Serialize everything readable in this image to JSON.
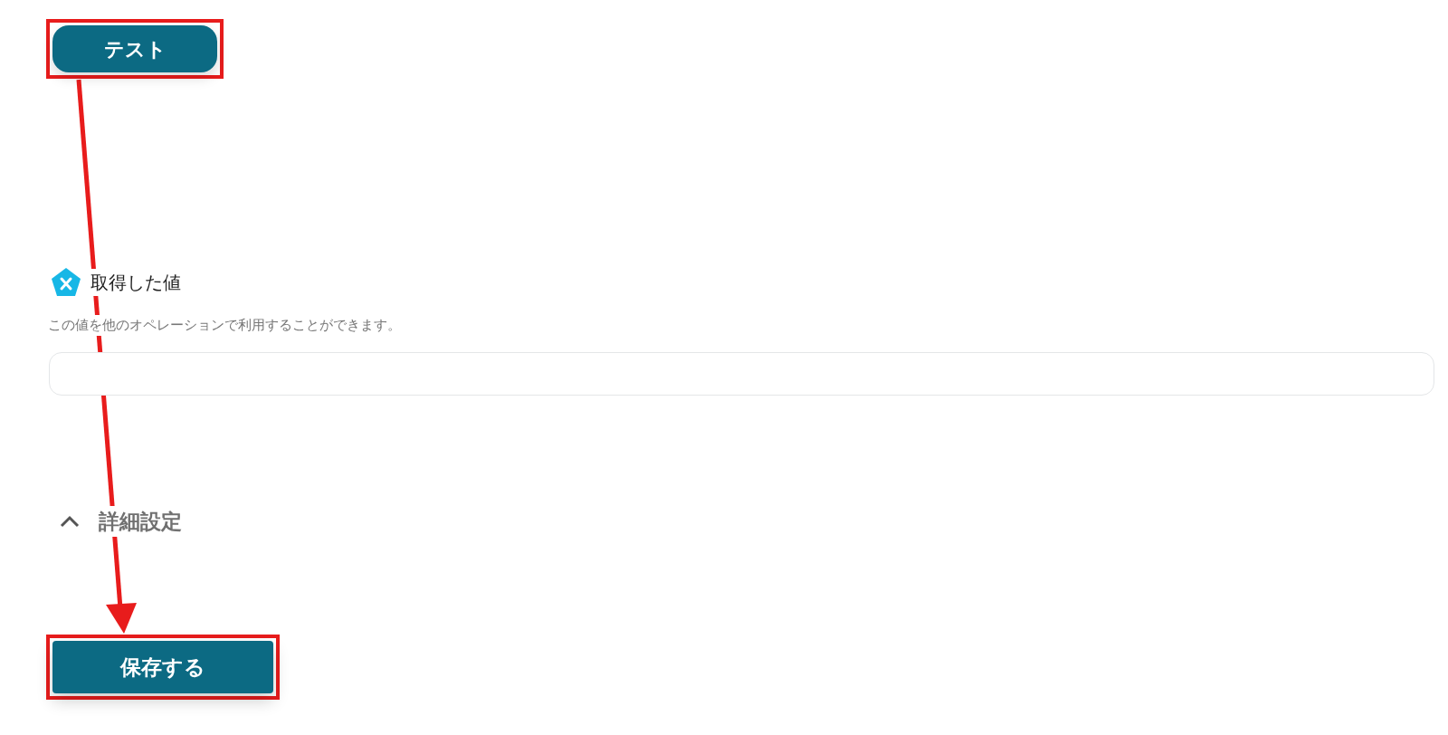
{
  "test_button": {
    "label": "テスト"
  },
  "output": {
    "label": "取得した値",
    "description": "この値を他のオペレーションで利用することができます。"
  },
  "advanced_settings": {
    "label": "詳細設定",
    "expanded": true
  },
  "save_button": {
    "label": "保存する"
  }
}
